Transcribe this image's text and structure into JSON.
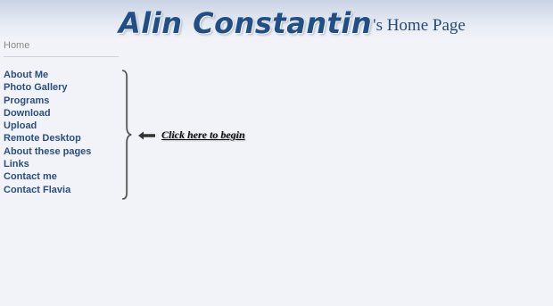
{
  "header": {
    "logo_name": "Alin Constantin",
    "logo_suffix": "'s Home Page"
  },
  "nav": {
    "home_label": "Home",
    "items": [
      {
        "label": "About Me"
      },
      {
        "label": "Photo Gallery"
      },
      {
        "label": "Programs"
      },
      {
        "label": "Download"
      },
      {
        "label": "Upload"
      },
      {
        "label": "Remote Desktop"
      },
      {
        "label": "About these pages"
      },
      {
        "label": "Links"
      },
      {
        "label": "Contact me"
      },
      {
        "label": "Contact Flavia"
      }
    ]
  },
  "hint": {
    "text": "Click here to begin",
    "icon": "left-arrow-icon"
  },
  "colors": {
    "background": "#f1f3f8",
    "logo": "#1f4f86",
    "link": "#2b4f7e",
    "home_link": "#8a8a8a"
  }
}
